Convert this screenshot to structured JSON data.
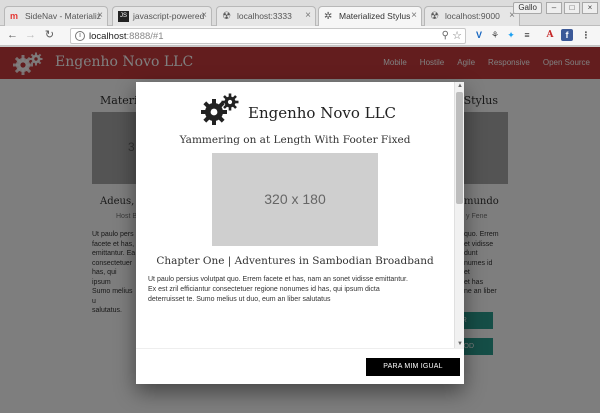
{
  "browser": {
    "tabs": [
      {
        "title": "SideNav - Materializ",
        "active": false
      },
      {
        "title": "javascript-powered",
        "active": false
      },
      {
        "title": "localhost:3333",
        "active": false
      },
      {
        "title": "Materialized Stylus",
        "active": true
      },
      {
        "title": "localhost:9000",
        "active": false
      }
    ],
    "profile": "Gallo",
    "url": {
      "host": "localhost",
      "path": ":8888/#1"
    }
  },
  "site": {
    "brand": "Engenho Novo LLC",
    "nav_links": [
      "Mobile",
      "Hostile",
      "Agile",
      "Responsive",
      "Open Source"
    ],
    "columns": [
      {
        "title": "Materi",
        "image_text": "3",
        "subtitle": "Adeus,",
        "sub2": "Host B",
        "text": [
          "Ut paulo pers",
          "facete et has,",
          "emittantur. Ea",
          "consectetuer",
          "has, qui ipsum",
          "Sumo melius u",
          "salutatus."
        ]
      },
      {
        "title": "n Stylus",
        "image_text": "",
        "subtitle": "mundo",
        "sub2": "y Fene",
        "text": [
          "quo. Errem",
          "et vidisse",
          "dunt",
          "numes id",
          "et",
          "et has",
          "ne an liber",
          ""
        ]
      }
    ],
    "buttons": [
      {
        "label": "DER"
      },
      {
        "label": "IN A MODAL MOOD"
      }
    ]
  },
  "modal": {
    "brand": "Engenho Novo LLC",
    "tagline": "Yammering on at Length With Footer Fixed",
    "image_text": "320 x 180",
    "chapter": "Chapter One | Adventures in Sambodian Broadband",
    "body_lines": [
      "Ut paulo persius volutpat quo. Errem facete et has, nam an sonet vidisse emittantur.",
      "Ex est zril efficiantur consectetuer regione nonumes id has, qui ipsum dicta",
      "deterruisset te. Sumo melius ut duo, eum an liber salutatus"
    ],
    "action_label": "PARA MIM IGUAL"
  },
  "colors": {
    "navbar": "#c73a3c",
    "teal_button": "#2a9d8f",
    "modal_action": "#000000"
  }
}
